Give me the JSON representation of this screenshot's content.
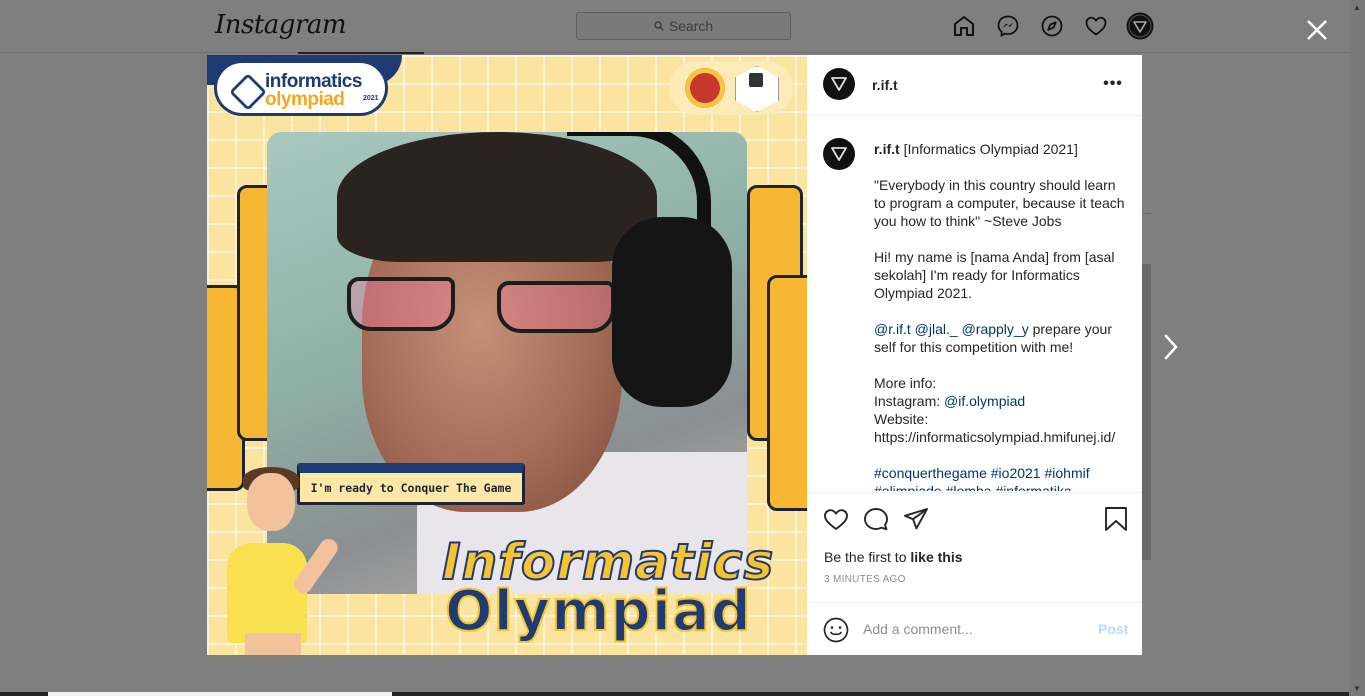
{
  "app": {
    "logo": "Instagram",
    "search_placeholder": "Search"
  },
  "nav": {
    "icons": [
      "home-icon",
      "messenger-icon",
      "explore-icon",
      "activity-heart-icon",
      "profile-avatar"
    ]
  },
  "media": {
    "logo_line1": "informatics",
    "logo_line2": "olympiad",
    "logo_year": "2021",
    "tagline": "I'm ready to Conquer The Game",
    "title_line1": "Informatics",
    "title_line2": "Olympiad"
  },
  "post": {
    "username": "r.if.t",
    "caption": {
      "username": "r.if.t",
      "headline": "[Informatics Olympiad 2021]",
      "quote": "\"Everybody in this country should learn to program a computer, because it teach you how to think\" ~Steve Jobs",
      "intro": "Hi! my name is [nama Anda] from [asal sekolah] I'm ready for Informatics Olympiad 2021.",
      "mention1": "@r.if.t",
      "mention2": "@jlal._",
      "mention3": "@rapply_y",
      "mention_text": " prepare your self for this competition with me!",
      "more_info": "More info:",
      "instagram_label": "Instagram: ",
      "instagram_handle": "@if.olympiad",
      "website_label": "Website:",
      "website_url": "https://informaticsolympiad.hmifunej.id/",
      "tag1": "#conquerthegame",
      "tag2": "#io2021",
      "tag3": "#iohmif",
      "tag_cutoff": "#olimpiade #lomba #informatika"
    },
    "likes_prefix": "Be the first to ",
    "likes_action": "like this",
    "timestamp": "3 MINUTES AGO",
    "comment_placeholder": "Add a comment...",
    "post_label": "Post"
  },
  "colors": {
    "link": "#00376b",
    "post_button": "#b3dbff",
    "overlay": "#7f7f7f"
  }
}
